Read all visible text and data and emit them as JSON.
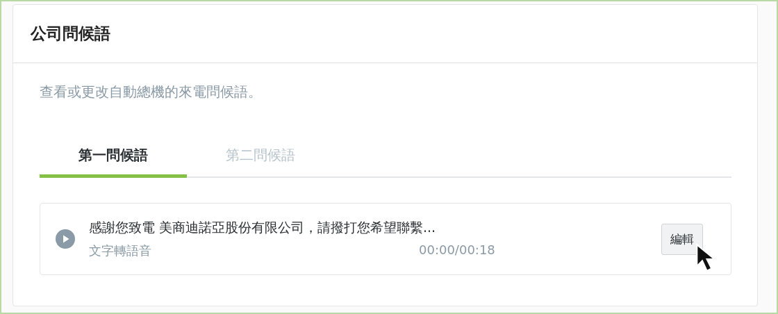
{
  "card": {
    "title": "公司問候語",
    "description": "查看或更改自動總機的來電問候語。"
  },
  "tabs": [
    {
      "label": "第一問候語",
      "selected": true
    },
    {
      "label": "第二問候語",
      "selected": false
    }
  ],
  "greeting": {
    "text": "感謝您致電 美商迪諾亞股份有限公司，請撥打您希望聯繫...",
    "type": "文字轉語音",
    "duration": "00:00/00:18",
    "edit_button": "編輯"
  }
}
